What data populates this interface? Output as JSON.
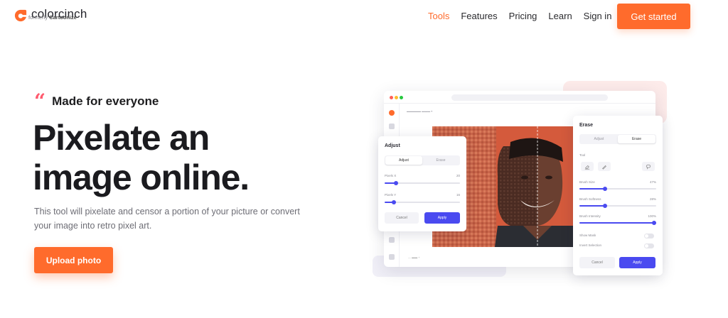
{
  "brand": {
    "name": "colorcinch",
    "sub_prefix": "formerly",
    "sub_name": "Cartoonize",
    "accent": "#ff6b2c"
  },
  "nav": {
    "links": [
      "Tools",
      "Features",
      "Pricing",
      "Learn",
      "Sign in"
    ],
    "active": "Tools",
    "cta": "Get started"
  },
  "hero": {
    "tagline": "Made for everyone",
    "title_line1": "Pixelate an",
    "title_line2": "image online.",
    "description": "This tool will pixelate and censor a portion of your picture or convert your image into retro pixel art.",
    "upload_label": "Upload photo"
  },
  "mockup": {
    "adjust_panel": {
      "title": "Adjust",
      "tabs": [
        "Adjust",
        "Erase"
      ],
      "active_tab": "Adjust",
      "sliders": [
        {
          "label": "Pixels X",
          "value": "20",
          "level": 0.15
        },
        {
          "label": "Pixels Y",
          "value": "16",
          "level": 0.12
        }
      ],
      "cancel": "Cancel",
      "apply": "Apply"
    },
    "erase_panel": {
      "title": "Erase",
      "tabs": [
        "Adjust",
        "Erase"
      ],
      "active_tab": "Erase",
      "tool_label": "Tool",
      "sliders": [
        {
          "label": "Brush Size",
          "value": "47%",
          "level": 0.33
        },
        {
          "label": "Brush Softness",
          "value": "28%",
          "level": 0.33
        },
        {
          "label": "Brush Intensity",
          "value": "100%",
          "level": 1.0
        }
      ],
      "toggles": [
        {
          "label": "Show Mask",
          "on": false
        },
        {
          "label": "Invert Selection",
          "on": false
        }
      ],
      "cancel": "Cancel",
      "apply": "Apply"
    },
    "icons": [
      "eraser-icon",
      "brush-icon",
      "lasso-icon"
    ]
  }
}
